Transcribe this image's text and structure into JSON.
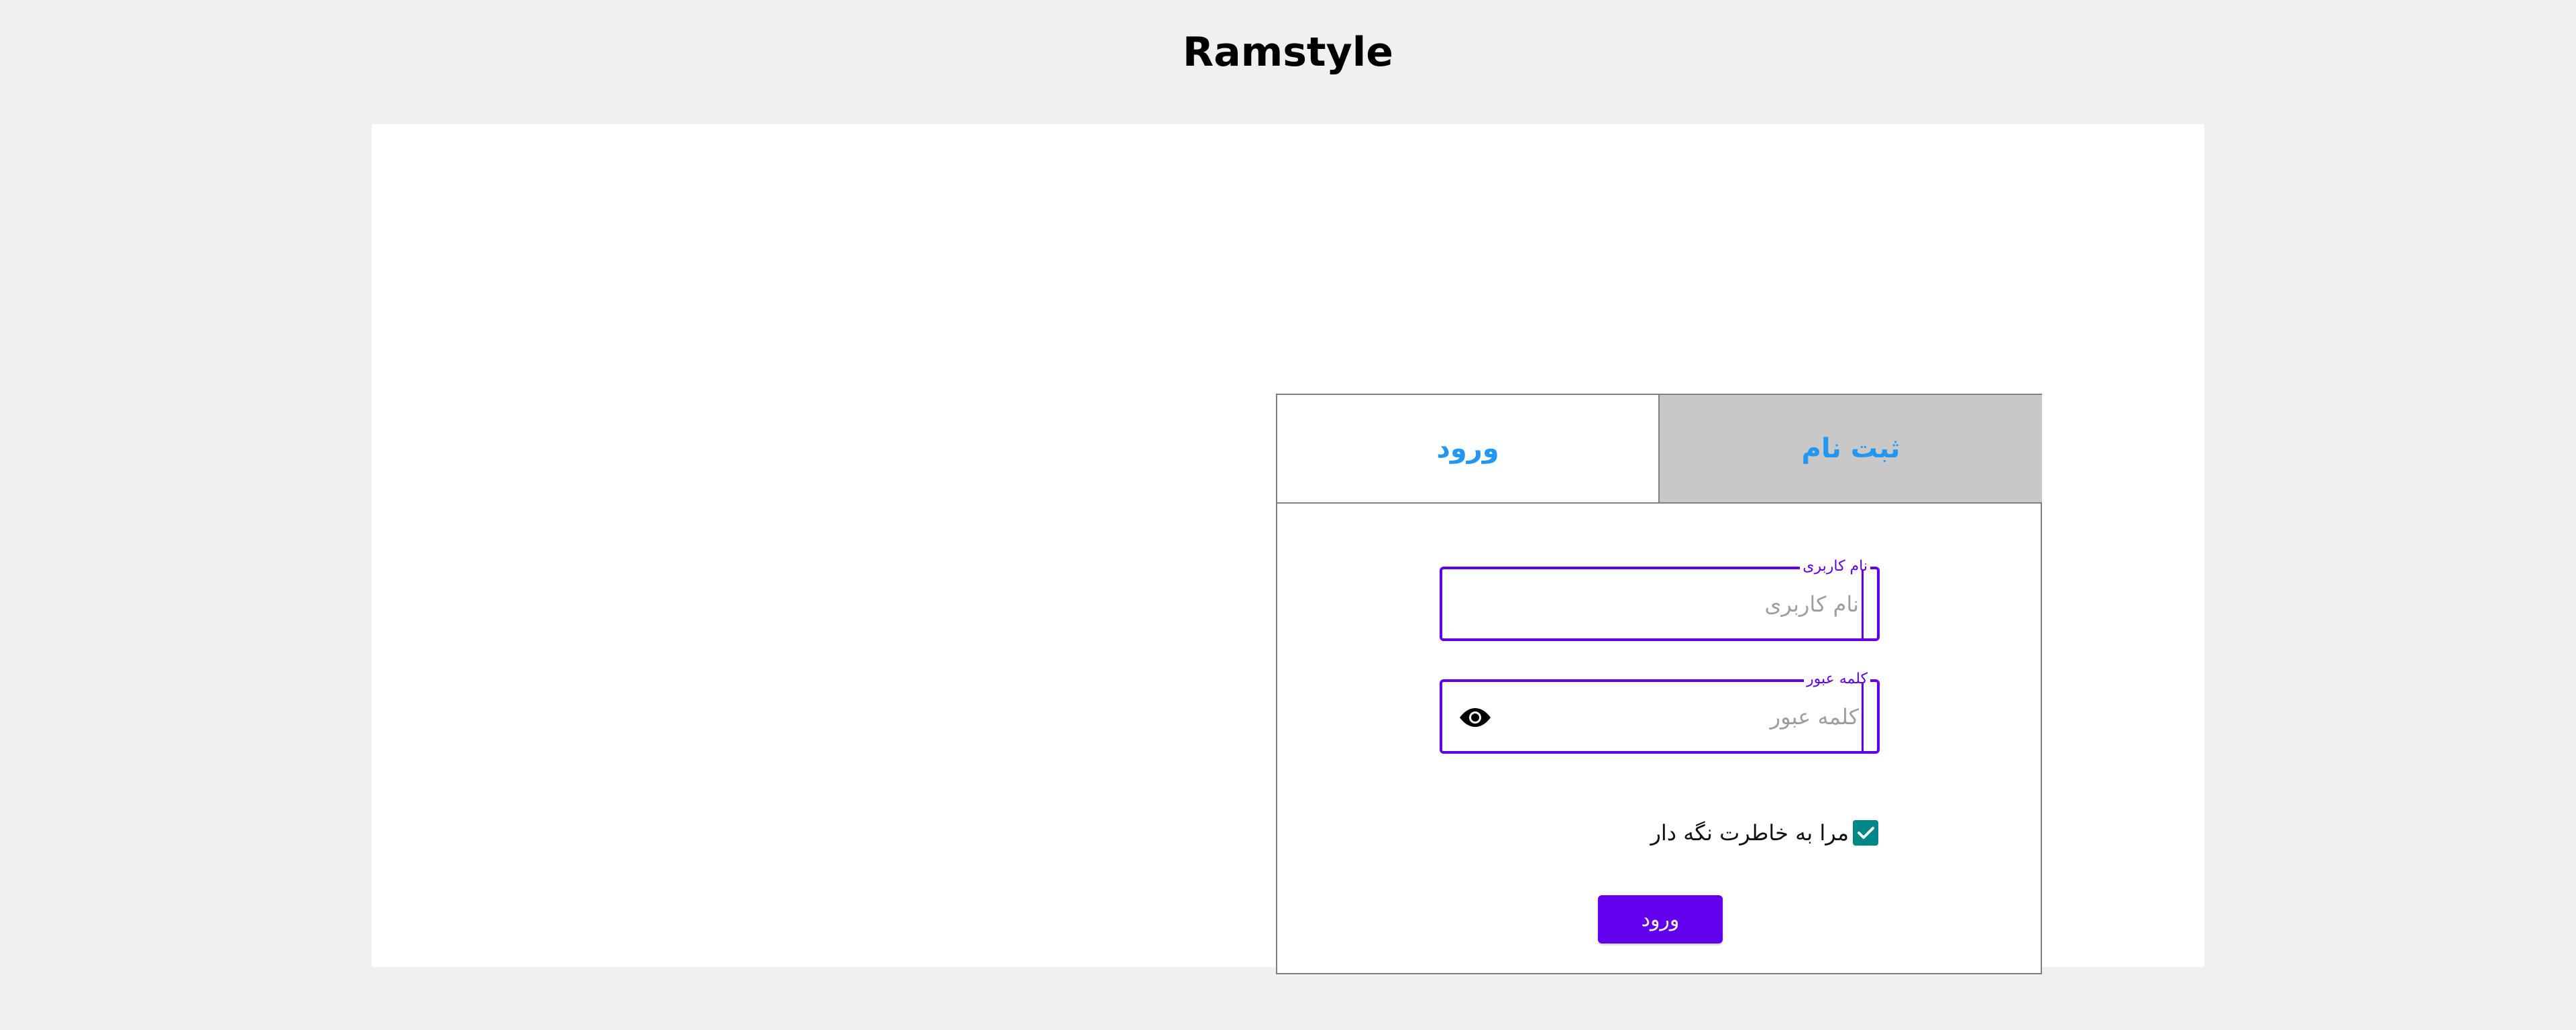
{
  "app": {
    "title": "Ramstyle"
  },
  "tabs": {
    "login_label": "ورود",
    "register_label": "ثبت نام",
    "active": "login"
  },
  "form": {
    "username": {
      "label": "نام کاربری",
      "placeholder": "نام کاربری",
      "value": ""
    },
    "password": {
      "label": "کلمه عبور",
      "placeholder": "کلمه عبور",
      "value": "",
      "toggle_icon": "eye-icon"
    },
    "remember_me": {
      "label": "مرا به خاطرت نگه دار",
      "checked": true,
      "icon": "checkmark-icon"
    },
    "submit_label": "ورود"
  },
  "colors": {
    "accent": "#6200ee",
    "tab_text": "#2196f3",
    "checkbox": "#018786",
    "inactive_tab_bg": "#c8c8c8",
    "page_bg": "#f0f0f0"
  }
}
